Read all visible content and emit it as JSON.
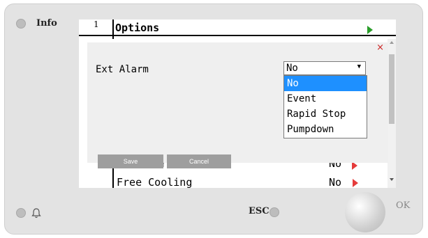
{
  "hardware": {
    "info_label": "Info",
    "esc_label": "ESC",
    "ok_label": "OK"
  },
  "menu": {
    "number": "1",
    "title": "Options",
    "items": [
      {
        "label": "Ext Alarm",
        "value": "No"
      },
      {
        "label": "Free Cooling",
        "value": "No"
      }
    ]
  },
  "dialog": {
    "close_label": "×",
    "field_label": "Ext Alarm",
    "selected_value": "No",
    "options": [
      "No",
      "Event",
      "Rapid Stop",
      "Pumpdown"
    ],
    "save_label": "Save",
    "cancel_label": "Cancel"
  },
  "colors": {
    "selection": "#1e90ff",
    "arrow_green": "#2a9d2a",
    "arrow_red": "#e53b3b",
    "panel": "#e3e3e3"
  },
  "icons": [
    "info-led-icon",
    "bell-icon",
    "esc-led-icon",
    "ok-knob"
  ]
}
